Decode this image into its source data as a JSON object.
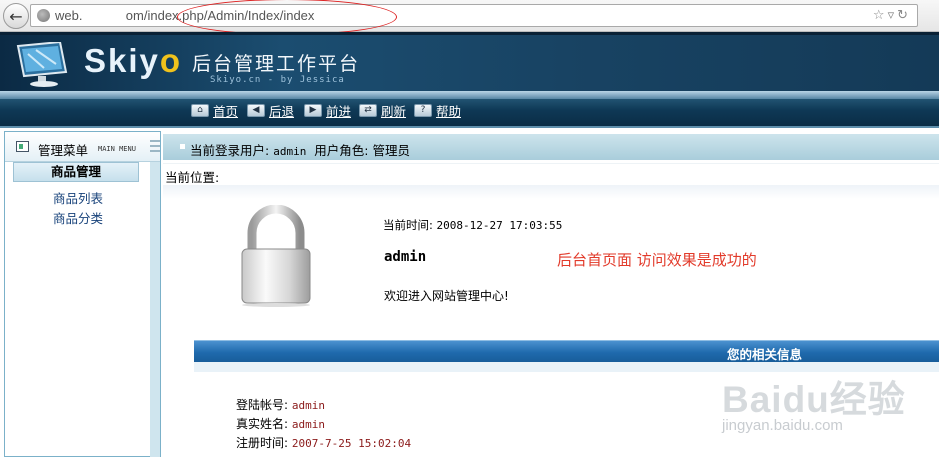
{
  "browser": {
    "url": "web.            om/index.php/Admin/Index/index"
  },
  "banner": {
    "logo_prefix": "Ski",
    "logo_o_y": "y",
    "logo_o": "o",
    "platform_title": "后台管理工作平台",
    "subtitle": "Skiyo.cn - by Jessica"
  },
  "nav": {
    "items": [
      {
        "label": "首页",
        "icon": "home-icon",
        "glyph": "⌂"
      },
      {
        "label": "后退",
        "icon": "back-arrow-icon",
        "glyph": "◀"
      },
      {
        "label": "前进",
        "icon": "forward-arrow-icon",
        "glyph": "▶"
      },
      {
        "label": "刷新",
        "icon": "refresh-icon",
        "glyph": "⇄"
      },
      {
        "label": "帮助",
        "icon": "help-icon",
        "glyph": "?"
      }
    ]
  },
  "sidebar": {
    "title": "管理菜单",
    "subtitle": "MAIN MENU",
    "section": "商品管理",
    "items": [
      {
        "label": "商品列表"
      },
      {
        "label": "商品分类"
      }
    ]
  },
  "info": {
    "user_label": "当前登录用户:",
    "user_value": "admin",
    "role_label": "用户角色:",
    "role_value": "管理员"
  },
  "location": {
    "label": "当前位置:"
  },
  "main": {
    "time_label": "当前时间:",
    "time_value": "2008-12-27 17:03:55",
    "username": "admin",
    "annotation": "后台首页面 访问效果是成功的",
    "welcome": "欢迎进入网站管理中心!"
  },
  "related": {
    "header": "您的相关信息",
    "rows": [
      {
        "label": "登陆帐号:",
        "value": "admin"
      },
      {
        "label": "真实姓名:",
        "value": "admin"
      },
      {
        "label": "注册时间:",
        "value": "2007-7-25 15:02:04"
      }
    ]
  },
  "watermark": {
    "brand": "Baidu经验",
    "url": "jingyan.baidu.com"
  },
  "colors": {
    "banner": "#1b4d70",
    "accent_blue": "#1f6aad",
    "annotation_red": "#e23a2a",
    "value_red": "#8b1a1a"
  }
}
